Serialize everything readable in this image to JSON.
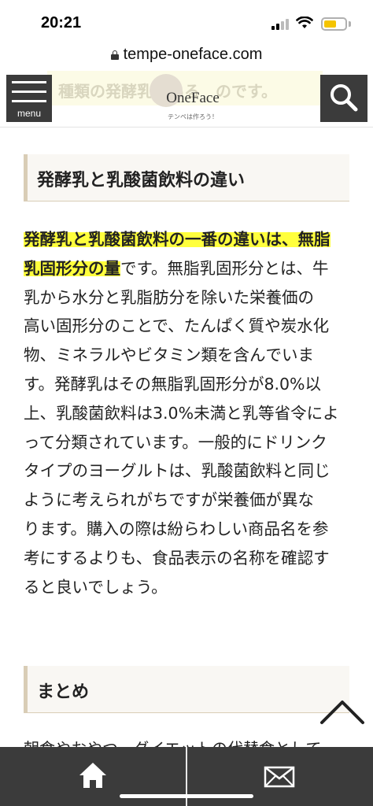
{
  "status_bar": {
    "time": "20:21",
    "battery_color": "#f5c400",
    "icons": [
      "signal-icon",
      "wifi-icon",
      "battery-icon"
    ]
  },
  "browser": {
    "url": "tempe-oneface.com",
    "icons": [
      "lock-icon"
    ]
  },
  "header": {
    "menu_label": "menu",
    "logo_text": "OneFace",
    "logo_tagline": "テンペは作ろう！",
    "partial_text_behind": "種類の発酵乳がある　のです。",
    "icons": [
      "hamburger-icon",
      "search-icon"
    ]
  },
  "article": {
    "heading1": "発酵乳と乳酸菌飲料の違い",
    "para_lines": [
      {
        "hl": "発酵乳と乳酸菌飲料の一番の違いは、無脂",
        "text": ""
      },
      {
        "hl": "乳固形分の量",
        "text": "です。無脂乳固形分とは、牛"
      },
      {
        "hl": "",
        "text": "乳から水分と乳脂肪分を除いた栄養価の"
      },
      {
        "hl": "",
        "text": "高い固形分のことで、たんぱく質や炭水化"
      },
      {
        "hl": "",
        "text": "物、ミネラルやビタミン類を含んでいま"
      },
      {
        "hl": "",
        "text": "す。発酵乳はその無脂乳固形分が8.0%以"
      },
      {
        "hl": "",
        "text": "上、乳酸菌飲料は3.0%未満と乳等省令によ"
      },
      {
        "hl": "",
        "text": "って分類されています。一般的にドリンク"
      },
      {
        "hl": "",
        "text": "タイプのヨーグルトは、乳酸菌飲料と同じ"
      },
      {
        "hl": "",
        "text": "ように考えられがちですが栄養価が異な"
      },
      {
        "hl": "",
        "text": "ります。購入の際は紛らわしい商品名を参"
      },
      {
        "hl": "",
        "text": "考にするよりも、食品表示の名称を確認す"
      },
      {
        "hl": "",
        "text": "ると良いでしょう。"
      }
    ],
    "heading2": "まとめ",
    "cut_line": "朝食やおやつ、ダイエットの代替食として",
    "highlight_color": "#ffff3d",
    "heading_border_color": "#d9cdb6"
  },
  "bottom_nav": {
    "icons": [
      "home-icon",
      "mail-icon",
      "chevron-up-icon"
    ]
  }
}
